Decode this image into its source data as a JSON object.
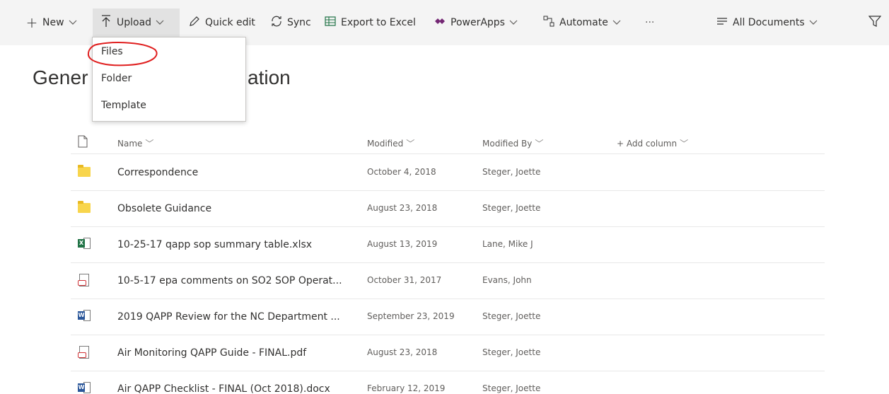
{
  "command_bar": {
    "new_label": "New",
    "upload_label": "Upload",
    "quick_edit_label": "Quick edit",
    "sync_label": "Sync",
    "export_label": "Export to Excel",
    "powerapps_label": "PowerApps",
    "automate_label": "Automate",
    "more_label": "···",
    "view_label": "All Documents"
  },
  "upload_menu": {
    "items": [
      "Files",
      "Folder",
      "Template"
    ],
    "annotation_color": "#e02020"
  },
  "page": {
    "title_visible_start": "Gener",
    "title_visible_end": "ation"
  },
  "table": {
    "headers": {
      "name": "Name",
      "modified": "Modified",
      "modified_by": "Modified By",
      "add_column": "Add column"
    },
    "rows": [
      {
        "type": "folder",
        "name": "Correspondence",
        "modified": "October 4, 2018",
        "modified_by": "Steger, Joette"
      },
      {
        "type": "folder",
        "name": "Obsolete Guidance",
        "modified": "August 23, 2018",
        "modified_by": "Steger, Joette"
      },
      {
        "type": "excel",
        "name": "10-25-17 qapp sop summary table.xlsx",
        "modified": "August 13, 2019",
        "modified_by": "Lane, Mike J"
      },
      {
        "type": "pdf",
        "name": "10-5-17 epa comments on SO2 SOP Operat...",
        "modified": "October 31, 2017",
        "modified_by": "Evans, John"
      },
      {
        "type": "word",
        "name": "2019 QAPP Review for the NC Department ...",
        "modified": "September 23, 2019",
        "modified_by": "Steger, Joette"
      },
      {
        "type": "pdf",
        "name": "Air Monitoring QAPP Guide - FINAL.pdf",
        "modified": "August 23, 2018",
        "modified_by": "Steger, Joette"
      },
      {
        "type": "word",
        "name": "Air QAPP Checklist - FINAL (Oct 2018).docx",
        "modified": "February 12, 2019",
        "modified_by": "Steger, Joette"
      }
    ]
  },
  "icons": {
    "new": "plus-icon",
    "upload": "upload-arrow-icon",
    "quick_edit": "pencil-icon",
    "sync": "sync-icon",
    "export": "excel-grid-icon",
    "powerapps": "powerapps-icon",
    "automate": "flow-icon",
    "view": "list-lines-icon",
    "filter": "filter-funnel-icon"
  }
}
